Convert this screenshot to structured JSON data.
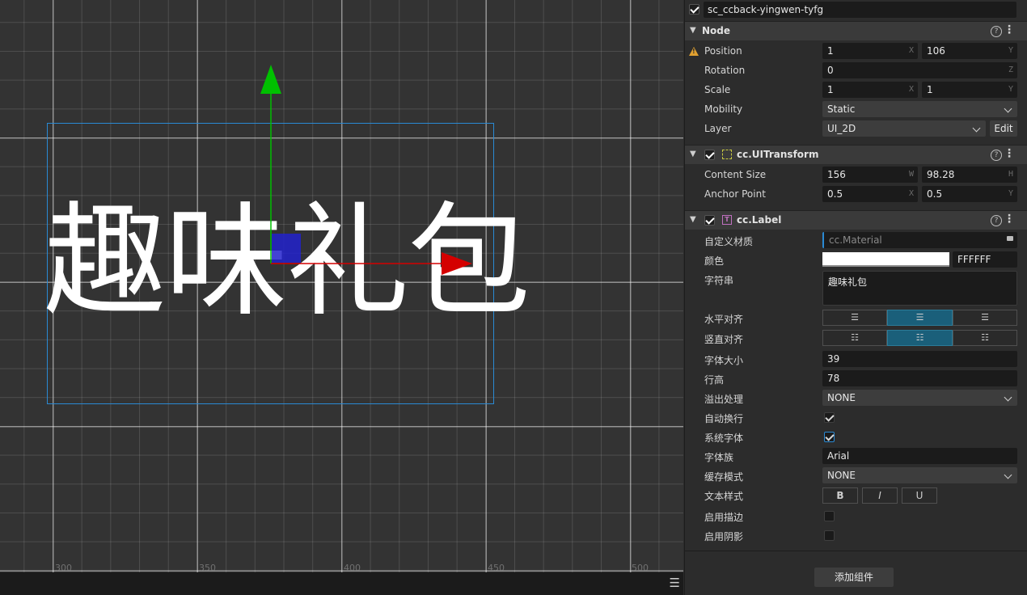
{
  "scene": {
    "label_text": "趣味礼包",
    "ruler": [
      "300",
      "350",
      "400",
      "450",
      "500"
    ]
  },
  "inspector": {
    "node_name": "sc_ccback-yingwen-tyfg",
    "node_section": {
      "title": "Node",
      "position_label": "Position",
      "position_x": "1",
      "position_y": "106",
      "rotation_label": "Rotation",
      "rotation_z": "0",
      "scale_label": "Scale",
      "scale_x": "1",
      "scale_y": "1",
      "mobility_label": "Mobility",
      "mobility_value": "Static",
      "layer_label": "Layer",
      "layer_value": "UI_2D",
      "edit_label": "Edit",
      "axis_x": "X",
      "axis_y": "Y",
      "axis_z": "Z"
    },
    "transform_section": {
      "title": "cc.UITransform",
      "content_size_label": "Content Size",
      "width": "156",
      "height": "98.28",
      "anchor_label": "Anchor Point",
      "anchor_x": "0.5",
      "anchor_y": "0.5",
      "axis_w": "W",
      "axis_h": "H"
    },
    "label_section": {
      "title": "cc.Label",
      "material_label": "自定义材质",
      "material_value": "cc.Material",
      "color_label": "颜色",
      "color_hex": "FFFFFF",
      "string_label": "字符串",
      "string_value": "趣味礼包",
      "h_align_label": "水平对齐",
      "v_align_label": "竖直对齐",
      "font_size_label": "字体大小",
      "font_size": "39",
      "line_height_label": "行高",
      "line_height": "78",
      "overflow_label": "溢出处理",
      "overflow_value": "NONE",
      "wrap_label": "自动换行",
      "system_font_label": "系统字体",
      "font_family_label": "字体族",
      "font_family_value": "Arial",
      "cache_mode_label": "缓存模式",
      "cache_mode_value": "NONE",
      "text_style_label": "文本样式",
      "bold": "B",
      "italic": "I",
      "underline": "U",
      "outline_label": "启用描边",
      "shadow_label": "启用阴影"
    },
    "add_component": "添加组件"
  },
  "colors": {
    "accent": "#1a5f7a",
    "bbox": "#2a8ad4",
    "gizmo_x": "#d40000",
    "gizmo_y": "#00c000",
    "gizmo_center": "#2222cc",
    "warning": "#e0a030"
  }
}
